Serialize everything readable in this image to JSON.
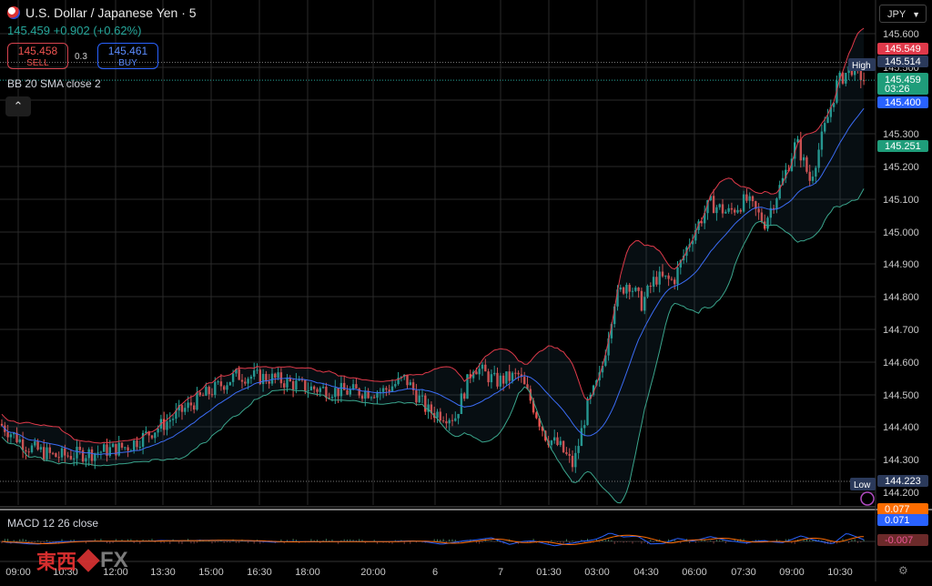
{
  "header": {
    "symbol": "U.S. Dollar / Japanese Yen · 5",
    "change": "145.459 +0.902 (+0.62%)",
    "sell_price": "145.458",
    "sell_label": "SELL",
    "buy_price": "145.461",
    "buy_label": "BUY",
    "spread": "0.3"
  },
  "indicators": {
    "bb": "BB 20 SMA close 2",
    "macd": "MACD 12 26 close"
  },
  "controls": {
    "currency": "JPY",
    "collapse_icon": "chevron-up-icon",
    "settings_icon": "gear-icon"
  },
  "branding": {
    "cn": "東西",
    "fx": "FX"
  },
  "colors": {
    "up": "#26a69a",
    "down": "#ef5350",
    "bb_upper": "#e03a4a",
    "bb_basis": "#3b6cf5",
    "bb_lower": "#3aa58c",
    "macd": "#2962ff",
    "signal": "#ff6d00"
  },
  "chart_data": {
    "type": "candlestick",
    "y_ticks": [
      "145.600",
      "145.500",
      "145.400",
      "145.300",
      "145.200",
      "145.100",
      "145.000",
      "144.900",
      "144.800",
      "144.700",
      "144.600",
      "144.500",
      "144.400",
      "144.300",
      "144.200"
    ],
    "x_ticks": [
      "09:00",
      "10:30",
      "12:00",
      "13:30",
      "15:00",
      "16:30",
      "18:00",
      "20:00",
      "6",
      "7",
      "01:30",
      "03:00",
      "04:30",
      "06:00",
      "07:30",
      "09:00",
      "10:30"
    ],
    "price_labels": [
      {
        "text": "145.549",
        "kind": "upper"
      },
      {
        "text": "High",
        "kind": "tag"
      },
      {
        "text": "145.514",
        "kind": "high"
      },
      {
        "text": "145.459",
        "kind": "last"
      },
      {
        "text": "03:26",
        "kind": "countdown"
      },
      {
        "text": "145.400",
        "kind": "basis"
      },
      {
        "text": "145.251",
        "kind": "lower"
      },
      {
        "text": "Low",
        "kind": "tag"
      },
      {
        "text": "144.223",
        "kind": "low"
      }
    ],
    "macd_labels": [
      {
        "text": "0.077",
        "kind": "signal"
      },
      {
        "text": "0.071",
        "kind": "macd"
      },
      {
        "text": "-0.007",
        "kind": "hist"
      }
    ],
    "high": 145.514,
    "low": 144.223,
    "last": 145.459
  }
}
